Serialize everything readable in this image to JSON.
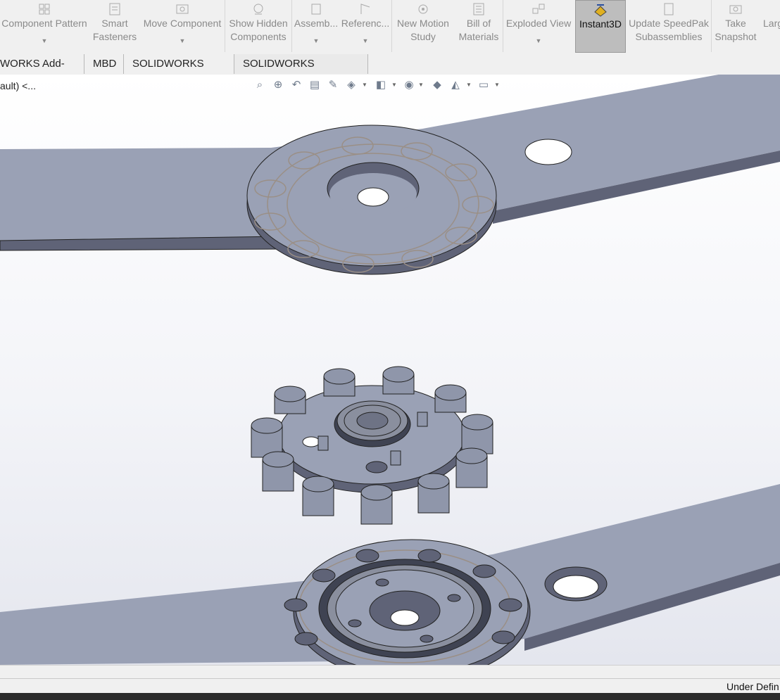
{
  "ribbon": {
    "buttons": [
      {
        "label": "Component Pattern",
        "icon": "pattern-icon",
        "dropdown": true
      },
      {
        "label": "Smart\nFasteners",
        "icon": "fastener-icon",
        "dropdown": false
      },
      {
        "label": "Move Component",
        "icon": "move-icon",
        "dropdown": true
      },
      {
        "label": "Show Hidden\nComponents",
        "icon": "show-hidden-icon",
        "dropdown": false
      },
      {
        "label": "Assemb...",
        "icon": "assembly-icon",
        "dropdown": true
      },
      {
        "label": "Referenc...",
        "icon": "reference-icon",
        "dropdown": true
      },
      {
        "label": "New Motion\nStudy",
        "icon": "motion-icon",
        "dropdown": false
      },
      {
        "label": "Bill of\nMaterials",
        "icon": "bom-icon",
        "dropdown": false
      },
      {
        "label": "Exploded View",
        "icon": "exploded-icon",
        "dropdown": true
      },
      {
        "label": "Instant3D",
        "icon": "instant3d-icon",
        "dropdown": false,
        "active": true
      },
      {
        "label": "Update SpeedPak\nSubassemblies",
        "icon": "speedpak-icon",
        "dropdown": false
      },
      {
        "label": "Take\nSnapshot",
        "icon": "camera-icon",
        "dropdown": false
      },
      {
        "label": "Larg",
        "icon": "large-icon",
        "dropdown": false
      }
    ]
  },
  "tabs": [
    "WORKS Add-Ins",
    "MBD",
    "SOLIDWORKS CAM",
    "SOLIDWORKS Inspection"
  ],
  "viewport": {
    "tree_label": "ault) <...",
    "hud_icons": [
      "zoom-to-fit-icon",
      "zoom-area-icon",
      "previous-view-icon",
      "section-view-icon",
      "dynamic-annotation-icon",
      "view-orientation-icon",
      "display-style-icon",
      "hide-show-icon",
      "edit-appearance-icon",
      "apply-scene-icon",
      "view-settings-icon"
    ]
  },
  "status": {
    "text": "Under Defin"
  },
  "colors": {
    "part_top": "#9aa1b5",
    "part_side": "#5f6377",
    "part_dark": "#464a5a",
    "ribbon_bg": "#f0f0f0"
  }
}
